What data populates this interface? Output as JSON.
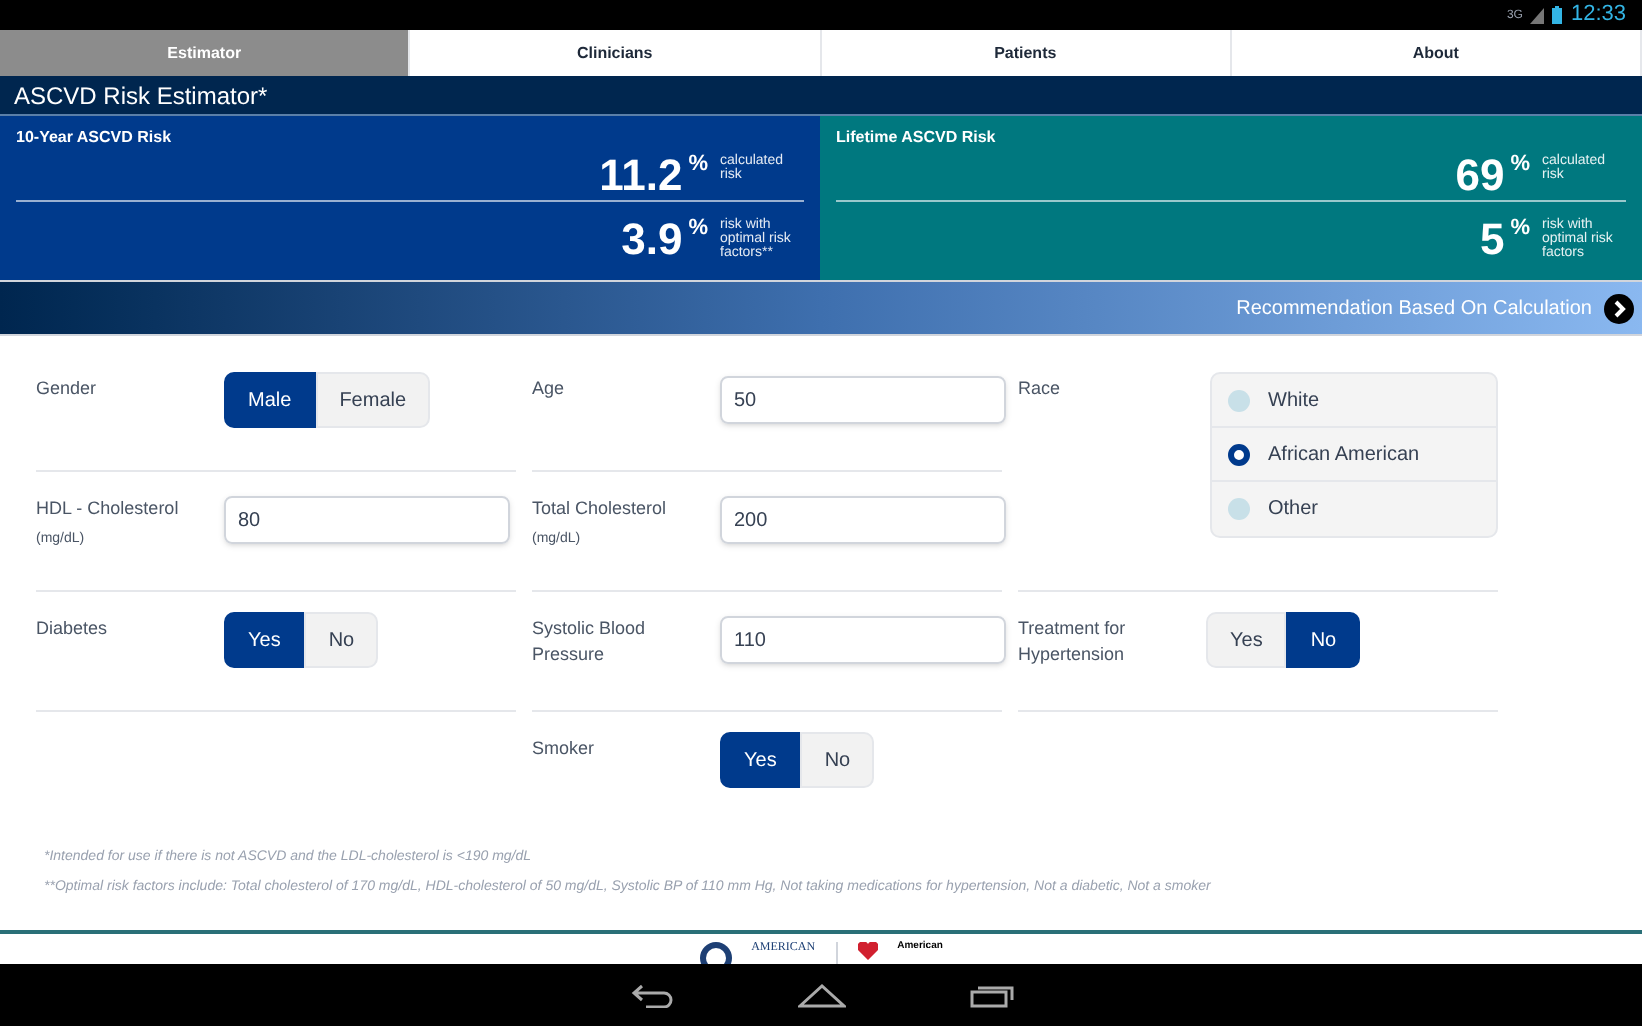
{
  "status_bar": {
    "network": "3G",
    "time": "12:33"
  },
  "tabs": [
    {
      "label": "Estimator",
      "selected": true
    },
    {
      "label": "Clinicians",
      "selected": false
    },
    {
      "label": "Patients",
      "selected": false
    },
    {
      "label": "About",
      "selected": false
    }
  ],
  "title": "ASCVD Risk Estimator*",
  "risk_panels": [
    {
      "title": "10-Year ASCVD Risk",
      "color": "#003a8c",
      "calculated": {
        "value": "11.2",
        "unit": "%",
        "label": "calculated risk"
      },
      "optimal": {
        "value": "3.9",
        "unit": "%",
        "label": "risk with optimal risk factors**"
      }
    },
    {
      "title": "Lifetime ASCVD Risk",
      "color": "#00787f",
      "calculated": {
        "value": "69",
        "unit": "%",
        "label": "calculated risk"
      },
      "optimal": {
        "value": "5",
        "unit": "%",
        "label": "risk with optimal risk factors"
      }
    }
  ],
  "recommendation": "Recommendation Based On Calculation",
  "form_columns": [
    [
      {
        "kind": "toggle",
        "label": "Gender",
        "options": [
          {
            "label": "Male",
            "selected": true
          },
          {
            "label": "Female",
            "selected": false
          }
        ]
      },
      {
        "kind": "input",
        "label": "HDL - Cholesterol",
        "unit": "(mg/dL)",
        "value": "80"
      },
      {
        "kind": "toggle",
        "label": "Diabetes",
        "options": [
          {
            "label": "Yes",
            "selected": true
          },
          {
            "label": "No",
            "selected": false
          }
        ]
      }
    ],
    [
      {
        "kind": "input",
        "label": "Age",
        "value": "50"
      },
      {
        "kind": "input",
        "label": "Total Cholesterol",
        "unit": "(mg/dL)",
        "value": "200"
      },
      {
        "kind": "input",
        "label": "Systolic Blood Pressure",
        "value": "110"
      },
      {
        "kind": "toggle",
        "label": "Smoker",
        "options": [
          {
            "label": "Yes",
            "selected": true
          },
          {
            "label": "No",
            "selected": false
          }
        ]
      }
    ],
    [
      {
        "kind": "radio",
        "label": "Race",
        "options": [
          {
            "label": "White",
            "selected": false
          },
          {
            "label": "African American",
            "selected": true
          },
          {
            "label": "Other",
            "selected": false
          }
        ]
      },
      {
        "kind": "toggle",
        "label": "Treatment for Hypertension",
        "options": [
          {
            "label": "Yes",
            "selected": false
          },
          {
            "label": "No",
            "selected": true
          }
        ]
      }
    ]
  ],
  "footnotes": [
    "*Intended for use if there is not ASCVD and the LDL-cholesterol is <190 mg/dL",
    "**Optimal risk factors include: Total cholesterol of 170 mg/dL, HDL-cholesterol of 50 mg/dL, Systolic BP of 110 mm Hg, Not taking medications for hypertension, Not a diabetic, Not a smoker"
  ],
  "footer_logos": [
    "AMERICAN",
    "American"
  ]
}
